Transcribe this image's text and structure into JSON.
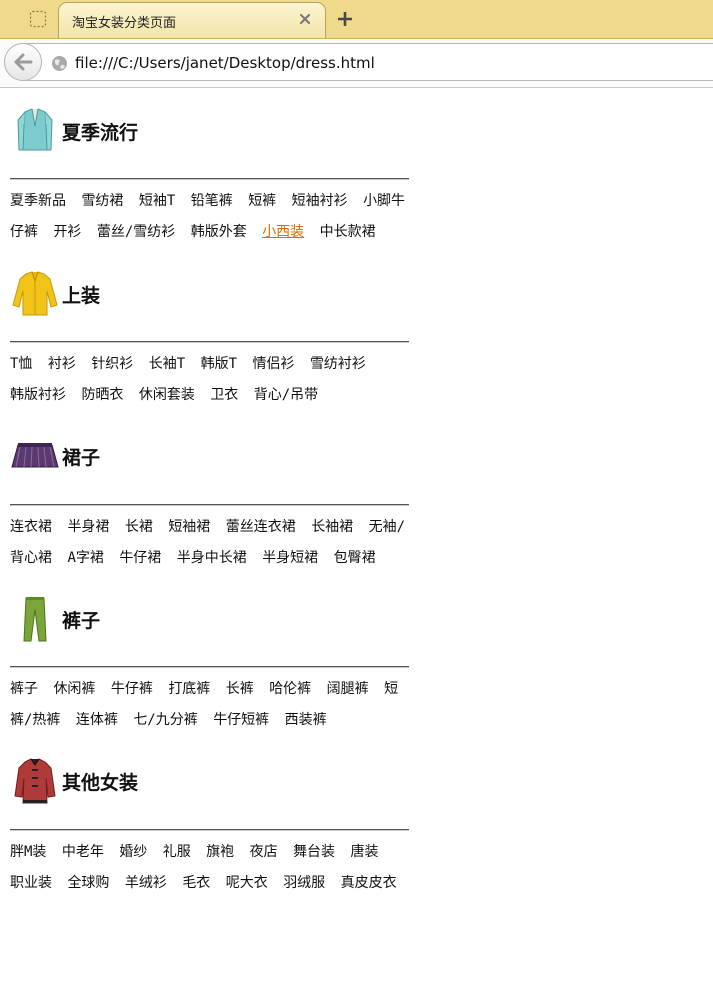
{
  "browser": {
    "tab_title": "淘宝女装分类页面",
    "url": "file:///C:/Users/janet/Desktop/dress.html"
  },
  "sections": [
    {
      "title": "夏季流行",
      "icon": "jacket-icon",
      "links": [
        "夏季新品",
        "雪纺裙",
        "短袖T",
        "铅笔裤",
        "短裤",
        "短袖衬衫",
        "小脚牛仔裤",
        "开衫",
        "蕾丝/雪纺衫",
        "韩版外套",
        "小西装",
        "中长款裙"
      ],
      "highlighted": "小西装"
    },
    {
      "title": "上装",
      "icon": "shirt-icon",
      "links": [
        "T恤",
        "衬衫",
        "针织衫",
        "长袖T",
        "韩版T",
        "情侣衫",
        "雪纺衬衫",
        "韩版衬衫",
        "防晒衣",
        "休闲套装",
        "卫衣",
        "背心/吊带"
      ]
    },
    {
      "title": "裙子",
      "icon": "skirt-icon",
      "links": [
        "连衣裙",
        "半身裙",
        "长裙",
        "短袖裙",
        "蕾丝连衣裙",
        "长袖裙",
        "无袖/背心裙",
        "A字裙",
        "牛仔裙",
        "半身中长裙",
        "半身短裙",
        "包臀裙"
      ]
    },
    {
      "title": "裤子",
      "icon": "pants-icon",
      "links": [
        "裤子",
        "休闲裤",
        "牛仔裤",
        "打底裤",
        "长裤",
        "哈伦裤",
        "阔腿裤",
        "短裤/热裤",
        "连体裤",
        "七/九分裤",
        "牛仔短裤",
        "西装裤"
      ]
    },
    {
      "title": "其他女装",
      "icon": "coat-icon",
      "links": [
        "胖M装",
        "中老年",
        "婚纱",
        "礼服",
        "旗袍",
        "夜店",
        "舞台装",
        "唐装",
        "职业装",
        "全球购",
        "羊绒衫",
        "毛衣",
        "呢大衣",
        "羽绒服",
        "真皮皮衣"
      ]
    }
  ]
}
